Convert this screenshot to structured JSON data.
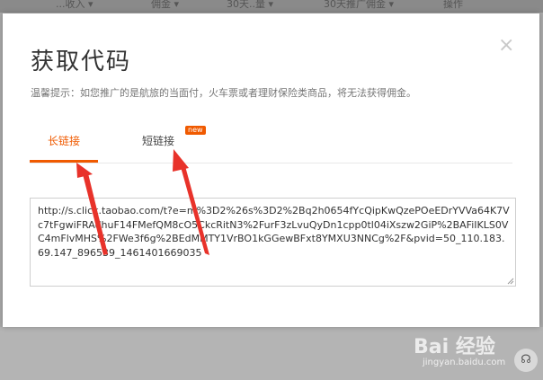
{
  "background_header": {
    "partial_texts": [
      "...收入 ▾",
      "佣金 ▾",
      "30天..量 ▾",
      "30天推广佣金 ▾",
      "操作"
    ]
  },
  "modal": {
    "title": "获取代码",
    "close_symbol": "×",
    "tip": "温馨提示：如您推广的是航旅的当面付，火车票或者理财保险类商品，将无法获得佣金。",
    "tabs": [
      {
        "label": "长链接",
        "active": true
      },
      {
        "label": "短链接",
        "active": false,
        "badge": "new"
      }
    ],
    "code": "http://s.click.taobao.com/t?e=m%3D2%26s%3D2%2Bq2h0654fYcQipKwQzePOeEDrYVVa64K7Vc7tFgwiFRAdhuF14FMefQM8cO5CkcRitN3%2FurF3zLvuQyDn1cpp0tl04iXszw2GiP%2BAFiIKLS0VC4mFlvMHS%2FWe3f6g%2BEdMMTY1VrBO1kGGewBFxt8YMXU3NNCg%2F&pvid=50_110.183.69.147_896539_1461401669035"
  },
  "watermark": {
    "main": "Bai 经验",
    "sub": "jingyan.baidu.com"
  },
  "help_icon": "headset-icon",
  "colors": {
    "accent": "#f05a00",
    "arrow": "#e8322a"
  }
}
